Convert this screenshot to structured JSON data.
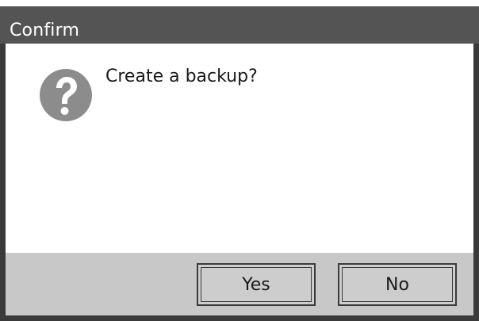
{
  "dialog": {
    "title": "Confirm",
    "message": "Create a backup?",
    "icon": "question-icon",
    "buttons": {
      "yes_label": "Yes",
      "no_label": "No"
    }
  },
  "colors": {
    "titlebar": "#545454",
    "frame": "#3a3a3a",
    "button_bar": "#c8c8c8",
    "button_face": "#cdcdcd",
    "icon": "#8c8c8c"
  }
}
